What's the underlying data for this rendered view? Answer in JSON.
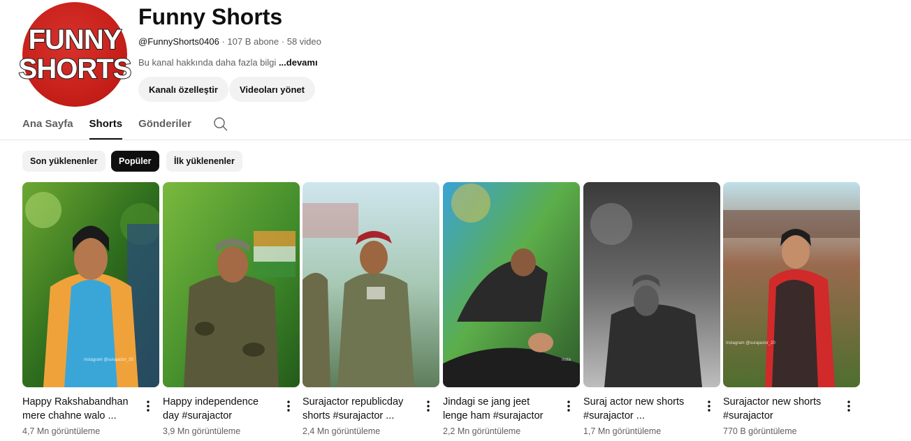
{
  "channel": {
    "avatar_text": [
      "FUNNY",
      "SHORTS"
    ],
    "title": "Funny Shorts",
    "handle": "@FunnyShorts0406",
    "subscribers": "107 B abone",
    "videos": "58 video",
    "about": "Bu kanal hakkında daha fazla bilgi",
    "about_more": "...devamı"
  },
  "buttons": {
    "customize": "Kanalı özelleştir",
    "manage": "Videoları yönet"
  },
  "tabs": [
    {
      "label": "Ana Sayfa",
      "active": false
    },
    {
      "label": "Shorts",
      "active": true
    },
    {
      "label": "Gönderiler",
      "active": false
    }
  ],
  "chips": [
    {
      "label": "Son yüklenenler",
      "active": false
    },
    {
      "label": "Popüler",
      "active": true
    },
    {
      "label": "İlk yüklenenler",
      "active": false
    }
  ],
  "shorts": [
    {
      "title_line1": "Happy Rakshabandhan",
      "title_line2": "mere chahne walo ...",
      "views": "4,7 Mn görüntüleme"
    },
    {
      "title_line1": "Happy independence",
      "title_line2": "day #surajactor",
      "views": "3,9 Mn görüntüleme"
    },
    {
      "title_line1": "Surajactor republicday",
      "title_line2": "shorts #surajactor ...",
      "views": "2,4 Mn görüntüleme"
    },
    {
      "title_line1": "Jindagi se jang jeet",
      "title_line2": "lenge ham #surajactor",
      "views": "2,2 Mn görüntüleme"
    },
    {
      "title_line1": "Suraj actor new shorts",
      "title_line2": "#surajactor ...",
      "views": "1,7 Mn görüntüleme"
    },
    {
      "title_line1": "Surajactor new shorts",
      "title_line2": "#surajactor",
      "views": "770 B görüntüleme"
    }
  ],
  "colors": {
    "accent": "#0f0f0f",
    "chip_bg": "#f2f2f2",
    "secondary_text": "#606060",
    "avatar_red": "#c7201b"
  },
  "icons": {
    "tab_search": "search-icon",
    "card_menu": "more-vert-icon"
  }
}
